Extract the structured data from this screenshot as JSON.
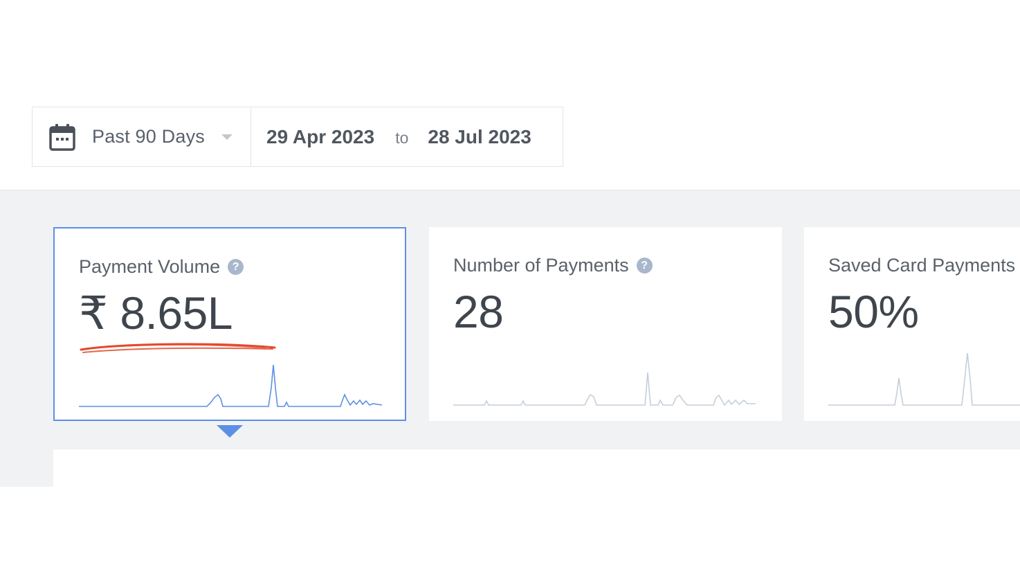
{
  "date_filter": {
    "preset_label": "Past 90 Days",
    "start_date": "29 Apr 2023",
    "to_label": "to",
    "end_date": "28 Jul 2023"
  },
  "metrics": [
    {
      "title": "Payment Volume",
      "value": "₹ 8.65L",
      "help": "?",
      "active": true
    },
    {
      "title": "Number of Payments",
      "value": "28",
      "help": "?",
      "active": false
    },
    {
      "title": "Saved Card Payments",
      "value": "50%",
      "active": false
    }
  ],
  "colors": {
    "accent": "#5d8fe6",
    "annotation": "#e24a2c",
    "spark_muted": "#c5ced8",
    "panel_bg": "#f0f2f4"
  }
}
